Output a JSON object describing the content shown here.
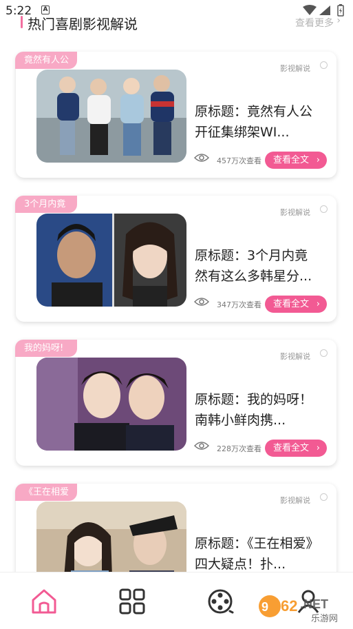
{
  "status_bar": {
    "time": "5:22",
    "notif_badge": "A"
  },
  "header": {
    "title": "热门喜剧影视解说",
    "more": "查看更多",
    "more_chevron": "›"
  },
  "cards": [
    {
      "tag": "竟然有人公",
      "category": "影视解说",
      "title": "原标题：竟然有人公开征集绑架WI...",
      "views": "457万次查看",
      "read_label": "查看全文"
    },
    {
      "tag": "3个月内竟",
      "category": "影视解说",
      "title": "原标题：3个月内竟然有这么多韩星分...",
      "views": "347万次查看",
      "read_label": "查看全文"
    },
    {
      "tag": "我的妈呀!",
      "category": "影视解说",
      "title": "原标题：我的妈呀！南韩小鲜肉携...",
      "views": "228万次查看",
      "read_label": "查看全文"
    },
    {
      "tag": "《王在相爱",
      "category": "影视解说",
      "title": "原标题：《王在相爱》四大疑点！扑...",
      "views": "",
      "read_label": ""
    }
  ],
  "read_chevron": "›",
  "nav": [
    {
      "name": "home",
      "icon": "home-icon",
      "active": true
    },
    {
      "name": "categories",
      "icon": "grid-icon",
      "active": false
    },
    {
      "name": "film",
      "icon": "film-reel-icon",
      "active": false
    },
    {
      "name": "profile",
      "icon": "user-icon",
      "active": false
    }
  ],
  "watermark": {
    "brand": "962.NET",
    "sub": "乐游网"
  },
  "colors": {
    "accent": "#f25a93",
    "tag": "#f8a9c5",
    "active_nav": "#f25a93"
  }
}
